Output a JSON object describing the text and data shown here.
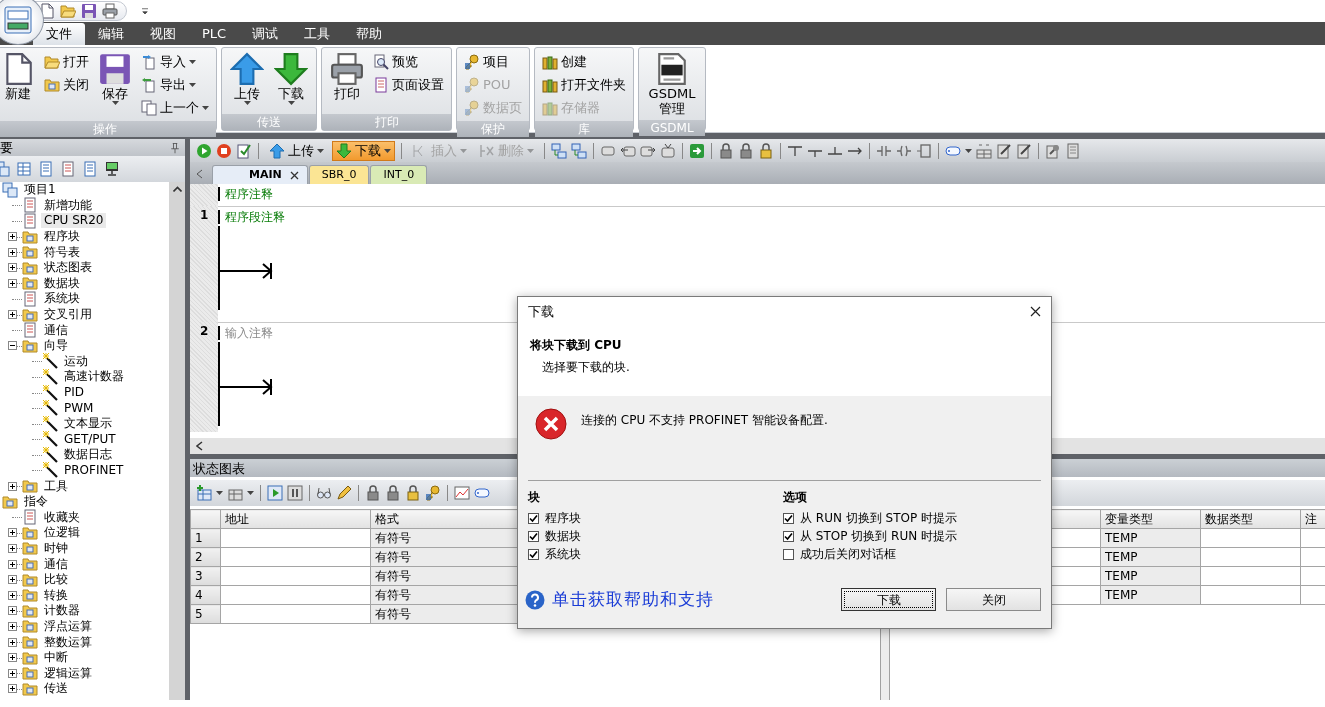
{
  "menu_tabs": [
    {
      "label": "文件",
      "selected": true
    },
    {
      "label": "编辑",
      "selected": false
    },
    {
      "label": "视图",
      "selected": false
    },
    {
      "label": "PLC",
      "selected": false
    },
    {
      "label": "调试",
      "selected": false
    },
    {
      "label": "工具",
      "selected": false
    },
    {
      "label": "帮助",
      "selected": false
    }
  ],
  "ribbon_groups": [
    {
      "title": "操作",
      "items": [
        {
          "label": "新建",
          "kind": "large",
          "dropdown": false,
          "disabled": false
        },
        {
          "label": "打开",
          "kind": "small",
          "dropdown": false,
          "disabled": false
        },
        {
          "label": "关闭",
          "kind": "small",
          "dropdown": false,
          "disabled": false
        },
        {
          "label": "保存",
          "kind": "large",
          "dropdown": true,
          "disabled": false
        },
        {
          "label": "导入",
          "kind": "small",
          "dropdown": true,
          "disabled": false
        },
        {
          "label": "导出",
          "kind": "small",
          "dropdown": true,
          "disabled": false
        },
        {
          "label": "上一个",
          "kind": "small",
          "dropdown": true,
          "disabled": false
        }
      ]
    },
    {
      "title": "传送",
      "items": [
        {
          "label": "上传",
          "kind": "large",
          "dropdown": true,
          "disabled": false
        },
        {
          "label": "下载",
          "kind": "large",
          "dropdown": true,
          "disabled": false
        }
      ]
    },
    {
      "title": "打印",
      "items": [
        {
          "label": "打印",
          "kind": "large",
          "dropdown": false,
          "disabled": false
        },
        {
          "label": "预览",
          "kind": "small",
          "dropdown": false,
          "disabled": false
        },
        {
          "label": "页面设置",
          "kind": "small",
          "dropdown": false,
          "disabled": false
        }
      ]
    },
    {
      "title": "保护",
      "items": [
        {
          "label": "项目",
          "kind": "small",
          "dropdown": false,
          "disabled": false
        },
        {
          "label": "POU",
          "kind": "small",
          "dropdown": false,
          "disabled": true
        },
        {
          "label": "数据页",
          "kind": "small",
          "dropdown": false,
          "disabled": true
        }
      ]
    },
    {
      "title": "库",
      "items": [
        {
          "label": "创建",
          "kind": "small",
          "dropdown": false,
          "disabled": false
        },
        {
          "label": "打开文件夹",
          "kind": "small",
          "dropdown": false,
          "disabled": false
        },
        {
          "label": "存储器",
          "kind": "small",
          "dropdown": false,
          "disabled": true
        }
      ]
    },
    {
      "title": "GSDML",
      "items": [
        {
          "label": "GSDML 管理",
          "kind": "large",
          "dropdown": false,
          "disabled": false
        }
      ]
    }
  ],
  "project_panel": {
    "title": "要",
    "tree": [
      {
        "label": "项目1",
        "selected": false,
        "expanded": true,
        "children": [
          {
            "label": "新增功能",
            "selected": false
          },
          {
            "label": "CPU SR20",
            "selected": true
          },
          {
            "label": "程序块",
            "selected": false,
            "expanded": false
          },
          {
            "label": "符号表",
            "selected": false,
            "expanded": false
          },
          {
            "label": "状态图表",
            "selected": false,
            "expanded": false
          },
          {
            "label": "数据块",
            "selected": false,
            "expanded": false
          },
          {
            "label": "系统块",
            "selected": false
          },
          {
            "label": "交叉引用",
            "selected": false,
            "expanded": false
          },
          {
            "label": "通信",
            "selected": false
          },
          {
            "label": "向导",
            "selected": false,
            "expanded": true,
            "children": [
              {
                "label": "运动",
                "selected": false
              },
              {
                "label": "高速计数器",
                "selected": false
              },
              {
                "label": "PID",
                "selected": false
              },
              {
                "label": "PWM",
                "selected": false
              },
              {
                "label": "文本显示",
                "selected": false
              },
              {
                "label": "GET/PUT",
                "selected": false
              },
              {
                "label": "数据日志",
                "selected": false
              },
              {
                "label": "PROFINET",
                "selected": false
              }
            ]
          },
          {
            "label": "工具",
            "selected": false,
            "expanded": false
          }
        ]
      },
      {
        "label": "指令",
        "selected": false,
        "expanded": true,
        "children": [
          {
            "label": "收藏夹",
            "selected": false
          },
          {
            "label": "位逻辑",
            "selected": false,
            "expanded": false
          },
          {
            "label": "时钟",
            "selected": false,
            "expanded": false
          },
          {
            "label": "通信",
            "selected": false,
            "expanded": false
          },
          {
            "label": "比较",
            "selected": false,
            "expanded": false
          },
          {
            "label": "转换",
            "selected": false,
            "expanded": false
          },
          {
            "label": "计数器",
            "selected": false,
            "expanded": false
          },
          {
            "label": "浮点运算",
            "selected": false,
            "expanded": false
          },
          {
            "label": "整数运算",
            "selected": false,
            "expanded": false
          },
          {
            "label": "中断",
            "selected": false,
            "expanded": false
          },
          {
            "label": "逻辑运算",
            "selected": false,
            "expanded": false
          },
          {
            "label": "传送",
            "selected": false,
            "expanded": false
          }
        ]
      }
    ]
  },
  "editor_toolbar": [
    {
      "label": "上传",
      "selected": false,
      "disabled": false
    },
    {
      "label": "下载",
      "selected": true,
      "disabled": false
    },
    {
      "label": "插入",
      "selected": false,
      "disabled": true
    },
    {
      "label": "删除",
      "selected": false,
      "disabled": true
    }
  ],
  "editor_tabs": [
    {
      "label": "MAIN",
      "selected": true,
      "color": "#e6edf7"
    },
    {
      "label": "SBR_0",
      "selected": false,
      "color": "#fbe594"
    },
    {
      "label": "INT_0",
      "selected": false,
      "color": "#d9eab5"
    }
  ],
  "editor": {
    "program_comment": "程序注释",
    "networks": [
      {
        "number": "1",
        "comment": "程序段注释",
        "kind": "comment"
      },
      {
        "number": "2",
        "comment": "输入注释",
        "kind": "hint"
      }
    ]
  },
  "status_chart": {
    "title": "状态图表",
    "columns": [
      "地址",
      "格式"
    ],
    "rows": [
      {
        "number": "1",
        "format": "有符号"
      },
      {
        "number": "2",
        "format": "有符号"
      },
      {
        "number": "3",
        "format": "有符号"
      },
      {
        "number": "4",
        "format": "有符号"
      },
      {
        "number": "5",
        "format": "有符号"
      }
    ]
  },
  "variable_table": {
    "columns": [
      "变量类型",
      "数据类型",
      "注"
    ],
    "rows": [
      {
        "var_type": "TEMP"
      },
      {
        "var_type": "TEMP"
      },
      {
        "var_type": "TEMP"
      },
      {
        "var_type": "TEMP"
      }
    ]
  },
  "dialog": {
    "title": "下载",
    "heading": "将块下载到 CPU",
    "subheading": "选择要下载的块.",
    "error": "连接的 CPU 不支持 PROFINET 智能设备配置.",
    "sections": [
      {
        "title": "块",
        "options": [
          {
            "label": "程序块",
            "checked": true
          },
          {
            "label": "数据块",
            "checked": true
          },
          {
            "label": "系统块",
            "checked": true
          }
        ]
      },
      {
        "title": "选项",
        "options": [
          {
            "label": "从 RUN 切换到 STOP 时提示",
            "checked": true
          },
          {
            "label": "从 STOP 切换到 RUN 时提示",
            "checked": true
          },
          {
            "label": "成功后关闭对话框",
            "checked": false
          }
        ]
      }
    ],
    "help_link": "单击获取帮助和支持",
    "buttons": [
      {
        "label": "下载",
        "default": true
      },
      {
        "label": "关闭",
        "default": false
      }
    ]
  }
}
